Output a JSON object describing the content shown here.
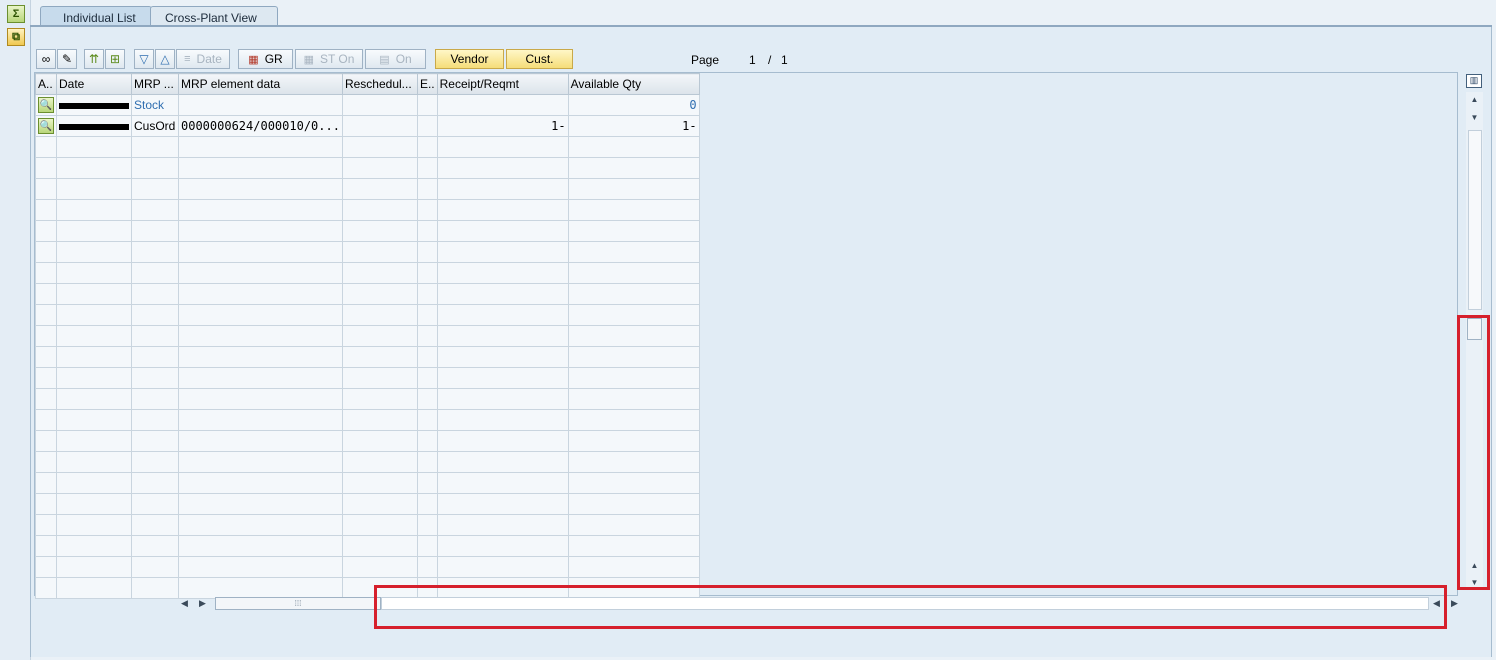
{
  "tabs": [
    {
      "label": "Individual List",
      "active": true
    },
    {
      "label": "Cross-Plant View",
      "active": false
    }
  ],
  "side_icons": [
    "sigma-icon",
    "export-icon"
  ],
  "toolbar": {
    "date_label": "Date",
    "gr_label": "GR",
    "st_on_label": "ST On",
    "on_label": "On",
    "vendor_label": "Vendor",
    "cust_label": "Cust."
  },
  "pager": {
    "label": "Page",
    "current": "1",
    "separator": "/",
    "total": "1"
  },
  "columns": [
    "A..",
    "Date",
    "MRP ...",
    "MRP element data",
    "Reschedul...",
    "E..",
    "Receipt/Reqmt",
    "Available Qty"
  ],
  "rows": [
    {
      "mrp": "Stock",
      "element_data": "",
      "reschedule": "",
      "e": "",
      "receipt": "",
      "available": "0"
    },
    {
      "mrp": "CusOrd",
      "element_data": "0000000624/000010/0...",
      "reschedule": "",
      "e": "",
      "receipt": "1-",
      "available": "1-"
    }
  ],
  "colors": {
    "highlight": "#d6202c",
    "accent": "#2f6eb0"
  }
}
